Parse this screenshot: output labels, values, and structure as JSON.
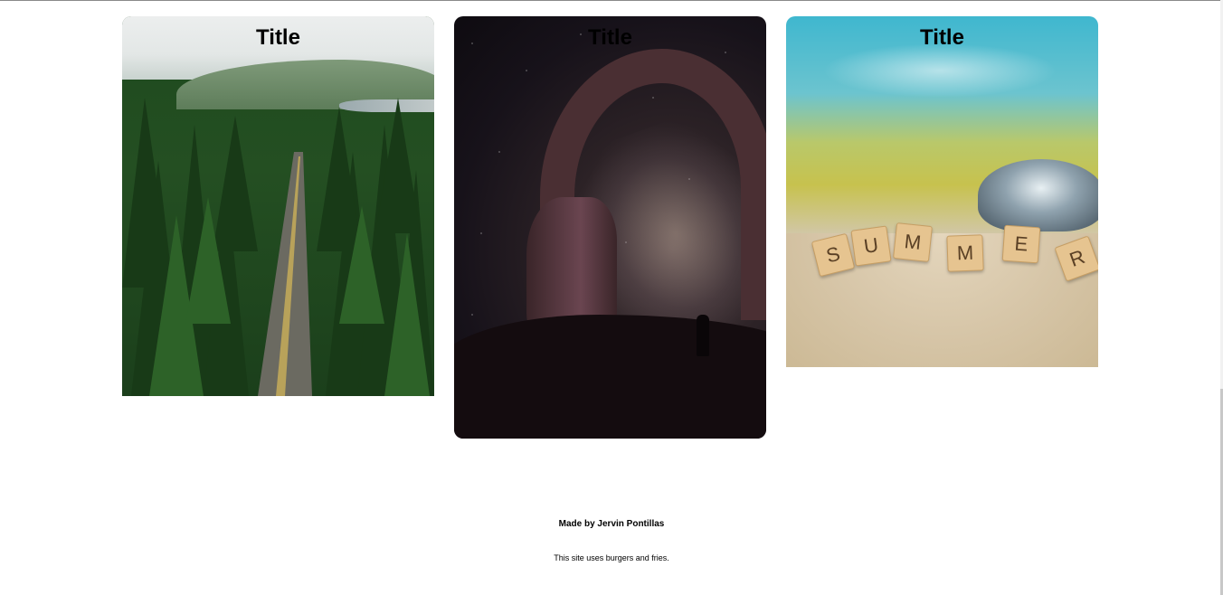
{
  "cards": [
    {
      "title": "Title",
      "image": "forest-road-aerial"
    },
    {
      "title": "Title",
      "image": "night-sky-rock-arch"
    },
    {
      "title": "Title",
      "image": "summer-scrabble-tiles-in-sand",
      "tiles": [
        "S",
        "U",
        "M",
        "M",
        "E",
        "R"
      ]
    }
  ],
  "footer": {
    "credit": "Made by Jervin Pontillas",
    "note": "This site uses burgers and fries."
  },
  "colors": {
    "background": "#ffffff",
    "text": "#000000"
  }
}
